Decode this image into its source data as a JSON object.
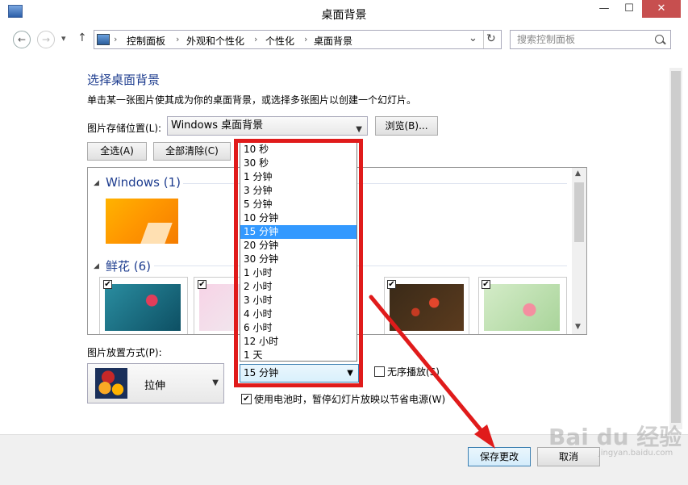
{
  "window": {
    "title": "桌面背景",
    "minimize": "—",
    "maximize": "☐",
    "close": "✕"
  },
  "nav": {
    "back": "←",
    "forward": "→",
    "dropdown": "▾",
    "up": "↑",
    "breadcrumbs": [
      "控制面板",
      "外观和个性化",
      "个性化",
      "桌面背景"
    ],
    "breadcrumb_sep": "›",
    "refresh": "↻",
    "addr_dropdown": "⌄",
    "search_placeholder": "搜索控制面板"
  },
  "main": {
    "heading": "选择桌面背景",
    "description": "单击某一张图片使其成为你的桌面背景，或选择多张图片以创建一个幻灯片。",
    "location_label": "图片存储位置(L):",
    "location_value": "Windows 桌面背景",
    "browse_button": "浏览(B)...",
    "select_all_button": "全选(A)",
    "clear_all_button": "全部清除(C)",
    "groups": [
      {
        "title": "Windows (1)"
      },
      {
        "title": "鲜花 (6)"
      }
    ],
    "checkmark": "✔",
    "position_label": "图片放置方式(P):",
    "position_value": "拉伸",
    "interval_options": [
      "10 秒",
      "30 秒",
      "1 分钟",
      "3 分钟",
      "5 分钟",
      "10 分钟",
      "15 分钟",
      "20 分钟",
      "30 分钟",
      "1 小时",
      "2 小时",
      "3 小时",
      "4 小时",
      "6 小时",
      "12 小时",
      "1 天"
    ],
    "interval_selected": "15 分钟",
    "shuffle_label": "无序播放(S)",
    "battery_label": "使用电池时，暂停幻灯片放映以节省电源(W)"
  },
  "footer": {
    "save_button": "保存更改",
    "cancel_button": "取消"
  },
  "watermark": {
    "text": "Bai du 经验",
    "sub": "jingyan.baidu.com"
  },
  "colors": {
    "accent": "#1e3d8f",
    "selection": "#3399ff",
    "annotation": "#e01b1b"
  }
}
